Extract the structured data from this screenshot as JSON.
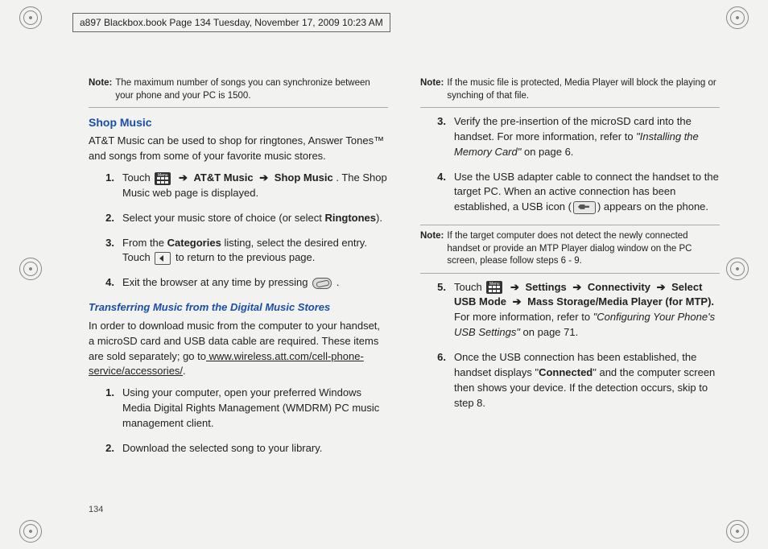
{
  "header": "a897 Blackbox.book  Page 134  Tuesday, November 17, 2009  10:23 AM",
  "page_number": "134",
  "arrow": "➔",
  "left": {
    "note1_label": "Note:",
    "note1_text": "The maximum number of songs you can synchronize between your phone and your PC is 1500.",
    "h_shop": "Shop Music",
    "shop_intro": "AT&T Music can be used to shop for ringtones, Answer Tones™ and songs from some of your favorite music stores.",
    "s1_a": "Touch ",
    "s1_b": "AT&T Music",
    "s1_c": "Shop Music",
    "s1_d": ". The Shop Music web page is displayed.",
    "s2_a": "Select your music store of choice (or select ",
    "s2_b": "Ringtones",
    "s2_c": ").",
    "s3_a": "From the ",
    "s3_b": "Categories",
    "s3_c": " listing, select the desired entry. Touch ",
    "s3_d": " to return to the previous page.",
    "s4_a": "Exit the browser at any time by pressing ",
    "s4_b": ".",
    "h_transfer": "Transferring Music from the Digital Music Stores",
    "transfer_intro_a": "In order to download music from the computer to your handset, a microSD card and USB data cable are required. These items are sold separately; go to",
    "transfer_link": " www.wireless.att.com/cell-phone-service/accessories/",
    "transfer_intro_b": ".",
    "t1": "Using your computer, open your preferred Windows Media Digital Rights Management (WMDRM) PC music management client.",
    "t2": "Download the selected song to your library."
  },
  "right": {
    "note2_label": "Note:",
    "note2_text": "If the music file is protected, Media Player will block the playing or synching of that file.",
    "r3_a": "Verify the pre-insertion of the microSD card into the handset. For more information, refer to ",
    "r3_b": "\"Installing the Memory Card\"",
    "r3_c": "  on page 6.",
    "r4_a": "Use the USB adapter cable to connect the handset to the target PC. When an active connection has been established, a USB icon (",
    "r4_b": ") appears on the phone.",
    "note3_label": "Note:",
    "note3_text": "If the target computer does not detect the newly connected handset or provide an MTP Player dialog window on the PC screen, please follow steps 6 - 9.",
    "r5_a": "Touch ",
    "r5_b": "Settings",
    "r5_c": "Connectivity",
    "r5_d": "Select USB Mode",
    "r5_e": "Mass Storage/Media Player (for MTP).",
    "r5_f": " For more information, refer to ",
    "r5_g": "\"Configuring Your Phone's USB Settings\"",
    "r5_h": "  on page 71.",
    "r6_a": "Once the USB connection has been established, the handset displays \"",
    "r6_b": "Connected",
    "r6_c": "\" and the computer screen then shows your device. If the detection occurs, skip to step 8."
  }
}
